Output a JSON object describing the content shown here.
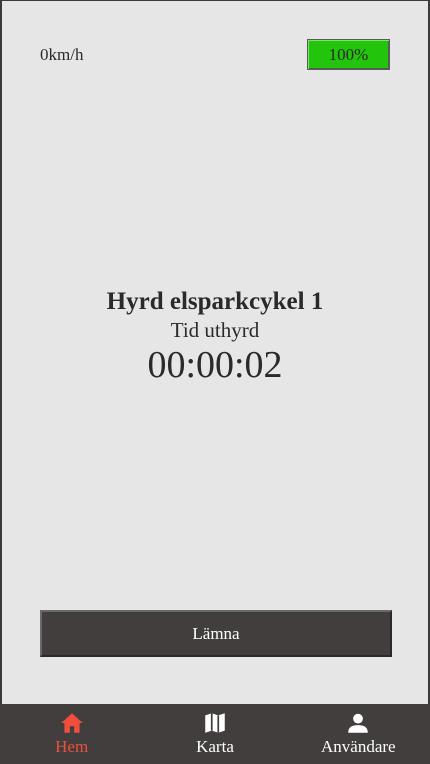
{
  "status": {
    "speed": "0km/h",
    "battery_label": "100%",
    "battery_level": 1.0,
    "battery_color": "#22c40c"
  },
  "rental": {
    "title": "Hyrd elsparkcykel 1",
    "subtitle": "Tid uthyrd",
    "elapsed": "00:00:02"
  },
  "actions": {
    "leave_label": "Lämna"
  },
  "nav": {
    "items": [
      {
        "label": "Hem",
        "icon": "home-icon",
        "active": true
      },
      {
        "label": "Karta",
        "icon": "map-icon",
        "active": false
      },
      {
        "label": "Användare",
        "icon": "user-icon",
        "active": false
      }
    ],
    "active_color": "#f04e3c"
  }
}
